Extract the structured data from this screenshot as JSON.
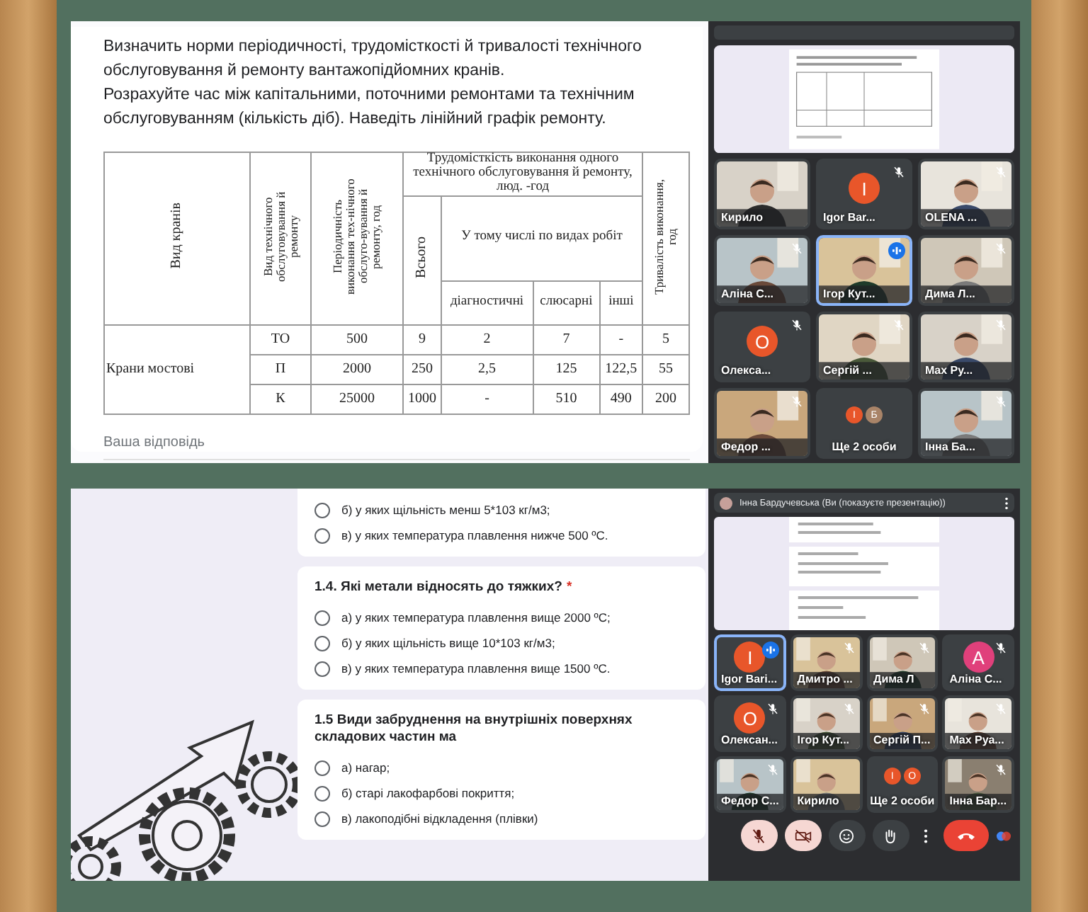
{
  "top": {
    "question": [
      "Визначить норми періодичності, трудомісткості й тривалості технічного обслуговування й ремонту вантажопідйомних кранів.",
      "Розрахуйте час між капітальними, поточними ремонтами та технічним обслуговуванням (кількість діб). Наведіть лінійний графік ремонту."
    ],
    "table": {
      "headers": {
        "crane_type": "Вид кранів",
        "service_type": "Вид технічного обслуговування й ремонту",
        "periodicity": "Періодичність виконання тех-нічного обслуго-вування й ремонту, год",
        "labour": "Трудомісткість виконання одного технічного обслуговування й ремонту, люд. -год",
        "total": "Всього",
        "by_work": "У тому числі по видах робіт",
        "diagnostic": "діагностичні",
        "fitting": "слюсарні",
        "other": "інші",
        "duration": "Тривалість виконання, год"
      },
      "crane": "Крани мостові",
      "rows": [
        [
          "ТО",
          "500",
          "9",
          "2",
          "7",
          "-",
          "5"
        ],
        [
          "П",
          "2000",
          "250",
          "2,5",
          "125",
          "122,5",
          "55"
        ],
        [
          "К",
          "25000",
          "1000",
          "-",
          "510",
          "490",
          "200"
        ]
      ]
    },
    "answer_placeholder": "Ваша відповідь",
    "meet": {
      "tiles": [
        {
          "kind": "video",
          "name": "Кирило",
          "muted": false,
          "speaking": false
        },
        {
          "kind": "avatar",
          "name": "Igor Bar...",
          "letter": "I",
          "color": "#e8562a",
          "muted": true,
          "speaking": false
        },
        {
          "kind": "video",
          "name": "OLENA ...",
          "muted": true,
          "speaking": false
        },
        {
          "kind": "video",
          "name": "Аліна С...",
          "muted": true,
          "speaking": false
        },
        {
          "kind": "video",
          "name": "Ігор Кут...",
          "muted": false,
          "speaking": true
        },
        {
          "kind": "video",
          "name": "Дима Л...",
          "muted": true,
          "speaking": false
        },
        {
          "kind": "avatar",
          "name": "Олекса...",
          "letter": "О",
          "color": "#e8562a",
          "muted": true,
          "speaking": false
        },
        {
          "kind": "video",
          "name": "Сергій ...",
          "muted": true,
          "speaking": false
        },
        {
          "kind": "video",
          "name": "Max Ру...",
          "muted": true,
          "speaking": false
        },
        {
          "kind": "video",
          "name": "Федор ...",
          "muted": true,
          "speaking": false
        },
        {
          "kind": "others",
          "name": "Ще 2 особи",
          "avatars": [
            {
              "letter": "I",
              "color": "#e8562a"
            },
            {
              "letter": "Б",
              "color": "#a98468"
            }
          ]
        },
        {
          "kind": "video",
          "name": "Інна Ба...",
          "muted": true,
          "speaking": false
        }
      ]
    }
  },
  "bottom": {
    "cards": [
      {
        "options": [
          {
            "label": "б) у яких щільність менш 5*103 кг/м3;",
            "selected": false
          },
          {
            "label": "в) у яких температура плавлення нижче 500 ºC.",
            "selected": false
          }
        ]
      },
      {
        "title": "1.4. Які метали відносять до тяжких?",
        "required_mark": "*",
        "options": [
          {
            "label": "а) у яких температура плавлення вище 2000 ºC;",
            "selected": false
          },
          {
            "label": "б) у яких щільність вище 10*103 кг/м3;",
            "selected": false
          },
          {
            "label": "в) у яких температура плавлення вище 1500 ºC.",
            "selected": false
          }
        ]
      },
      {
        "title": "1.5 Види забруднення на внутрішніх поверхнях складових частин ма",
        "options": [
          {
            "label": "а) нагар;",
            "selected": false
          },
          {
            "label": "б) старі лакофарбові покриття;",
            "selected": false
          },
          {
            "label": "в) лакоподібні відкладення (плівки)",
            "selected": false
          }
        ]
      }
    ],
    "meet": {
      "presenter": "Інна Бардучевська (Ви (показуєте презентацію))",
      "tiles": [
        {
          "kind": "avatar",
          "name": "Igor Barі...",
          "letter": "I",
          "color": "#e8562a",
          "muted": false,
          "speaking": true
        },
        {
          "kind": "video",
          "name": "Дмитро ...",
          "muted": true,
          "speaking": false
        },
        {
          "kind": "video",
          "name": "Дима Л",
          "muted": true,
          "speaking": false
        },
        {
          "kind": "avatar",
          "name": "Аліна С...",
          "letter": "A",
          "color": "#e0407b",
          "muted": true,
          "speaking": false
        },
        {
          "kind": "avatar",
          "name": "Олексан...",
          "letter": "О",
          "color": "#e8562a",
          "muted": true,
          "speaking": false
        },
        {
          "kind": "video",
          "name": "Ігор Кут...",
          "muted": true,
          "speaking": false
        },
        {
          "kind": "video",
          "name": "Сергій П...",
          "muted": true,
          "speaking": false
        },
        {
          "kind": "video",
          "name": "Max Руа...",
          "muted": true,
          "speaking": false
        },
        {
          "kind": "video",
          "name": "Федор С...",
          "muted": true,
          "speaking": false
        },
        {
          "kind": "video",
          "name": "Кирило",
          "muted": false,
          "speaking": false
        },
        {
          "kind": "others",
          "name": "Ще 2 особи",
          "avatars": [
            {
              "letter": "I",
              "color": "#e8562a"
            },
            {
              "letter": "О",
              "color": "#e8562a"
            }
          ]
        },
        {
          "kind": "video",
          "name": "Інна Бар...",
          "muted": true,
          "speaking": false
        }
      ],
      "controls": [
        {
          "kind": "mic",
          "on": false
        },
        {
          "kind": "camera",
          "on": false
        },
        {
          "kind": "emoji"
        },
        {
          "kind": "hand"
        },
        {
          "kind": "more"
        },
        {
          "kind": "hangup"
        }
      ]
    }
  }
}
